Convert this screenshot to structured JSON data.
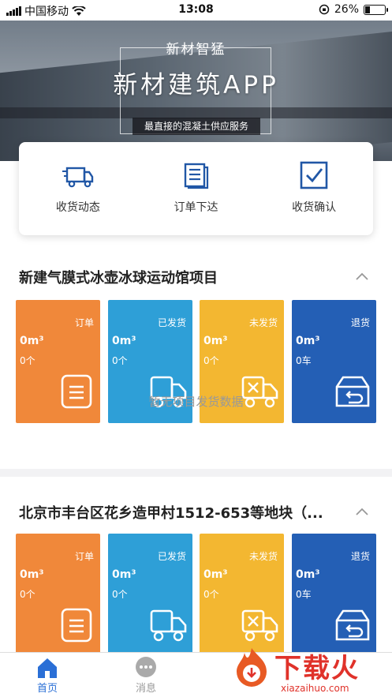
{
  "status_bar": {
    "carrier": "中国移动",
    "time": "13:08",
    "battery": "26%",
    "battery_level": 0.26
  },
  "hero": {
    "brand": "新材智猛",
    "title": "新材建筑APP",
    "subtitle": "最直接的混凝土供应服务"
  },
  "quick_actions": [
    {
      "label": "收货动态",
      "icon": "truck-icon"
    },
    {
      "label": "订单下达",
      "icon": "order-list-icon"
    },
    {
      "label": "收货确认",
      "icon": "checkbox-icon"
    }
  ],
  "projects": [
    {
      "name": "新建气膜式冰壶冰球运动馆项目",
      "empty_note": "暂无项目发货数据",
      "tiles": [
        {
          "label": "订单",
          "volume": "0m³",
          "count": "0个",
          "color": "#f0883a",
          "icon": "document-icon"
        },
        {
          "label": "已发货",
          "volume": "0m³",
          "count": "0个",
          "color": "#2e9fd7",
          "icon": "truck-icon"
        },
        {
          "label": "未发货",
          "volume": "0m³",
          "count": "0个",
          "color": "#f3b731",
          "icon": "truck-x-icon"
        },
        {
          "label": "退货",
          "volume": "0m³",
          "count": "0车",
          "color": "#245fb5",
          "icon": "return-box-icon"
        }
      ]
    },
    {
      "name": "北京市丰台区花乡造甲村1512-653等地块（...",
      "tiles": [
        {
          "label": "订单",
          "volume": "0m³",
          "count": "0个",
          "color": "#f0883a",
          "icon": "document-icon"
        },
        {
          "label": "已发货",
          "volume": "0m³",
          "count": "0个",
          "color": "#2e9fd7",
          "icon": "truck-icon"
        },
        {
          "label": "未发货",
          "volume": "0m³",
          "count": "0个",
          "color": "#f3b731",
          "icon": "truck-x-icon"
        },
        {
          "label": "退货",
          "volume": "0m³",
          "count": "0车",
          "color": "#245fb5",
          "icon": "return-box-icon"
        }
      ]
    }
  ],
  "tab_bar": [
    {
      "label": "首页",
      "active": true
    },
    {
      "label": "消息",
      "active": false
    }
  ],
  "watermark": {
    "text": "下载火",
    "url": "xiazaihuo.com"
  },
  "colors": {
    "accent": "#2a6fd6",
    "tab_active": "#2a6fd6",
    "tab_inactive": "#999999"
  }
}
